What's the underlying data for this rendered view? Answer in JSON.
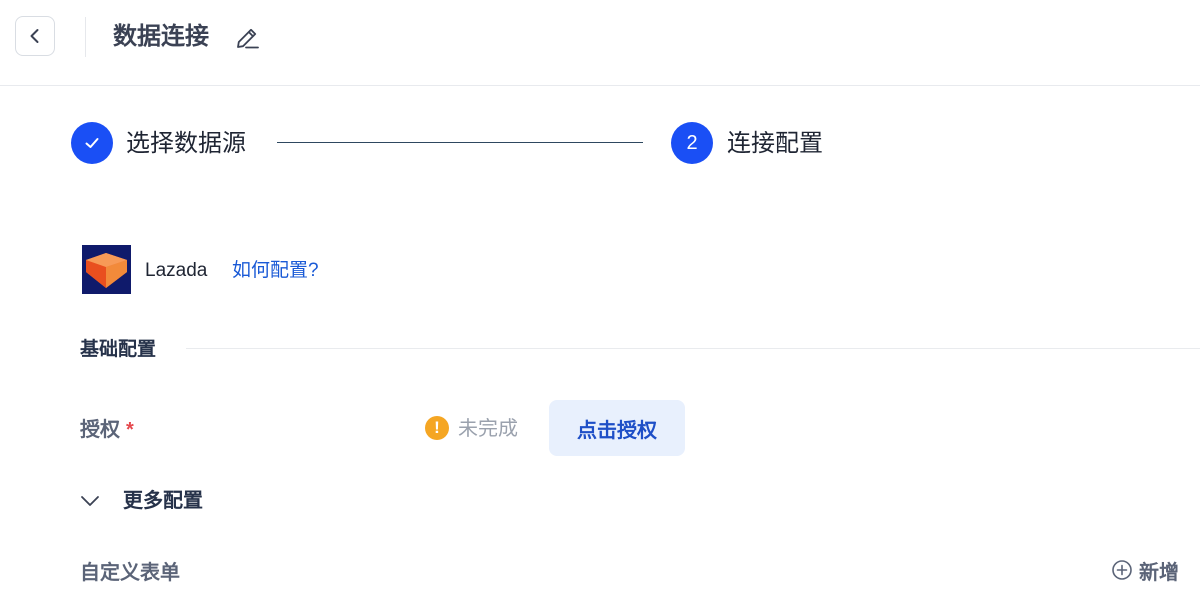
{
  "header": {
    "title": "数据连接",
    "back_icon": "chevron-left-icon",
    "edit_icon": "pencil-edit-icon"
  },
  "steps": [
    {
      "label": "选择数据源",
      "state": "completed",
      "icon": "check-icon"
    },
    {
      "label": "连接配置",
      "state": "active",
      "number": "2"
    }
  ],
  "source": {
    "name": "Lazada",
    "help_link": "如何配置?",
    "logo_icon": "lazada-logo-icon"
  },
  "basic_config": {
    "title": "基础配置",
    "auth": {
      "label": "授权",
      "required_mark": "*",
      "status_icon": "warning-exclamation-icon",
      "status_text": "未完成",
      "button_label": "点击授权"
    }
  },
  "more_config": {
    "label": "更多配置",
    "icon": "chevron-down-icon"
  },
  "custom_form": {
    "label": "自定义表单",
    "add_label": "新增",
    "add_icon": "plus-circle-icon"
  },
  "colors": {
    "primary": "#1a4ff5",
    "link": "#1a5ad6",
    "warning": "#f5a623",
    "required": "#e5484d",
    "auth_button_bg": "#e8f0fd"
  }
}
